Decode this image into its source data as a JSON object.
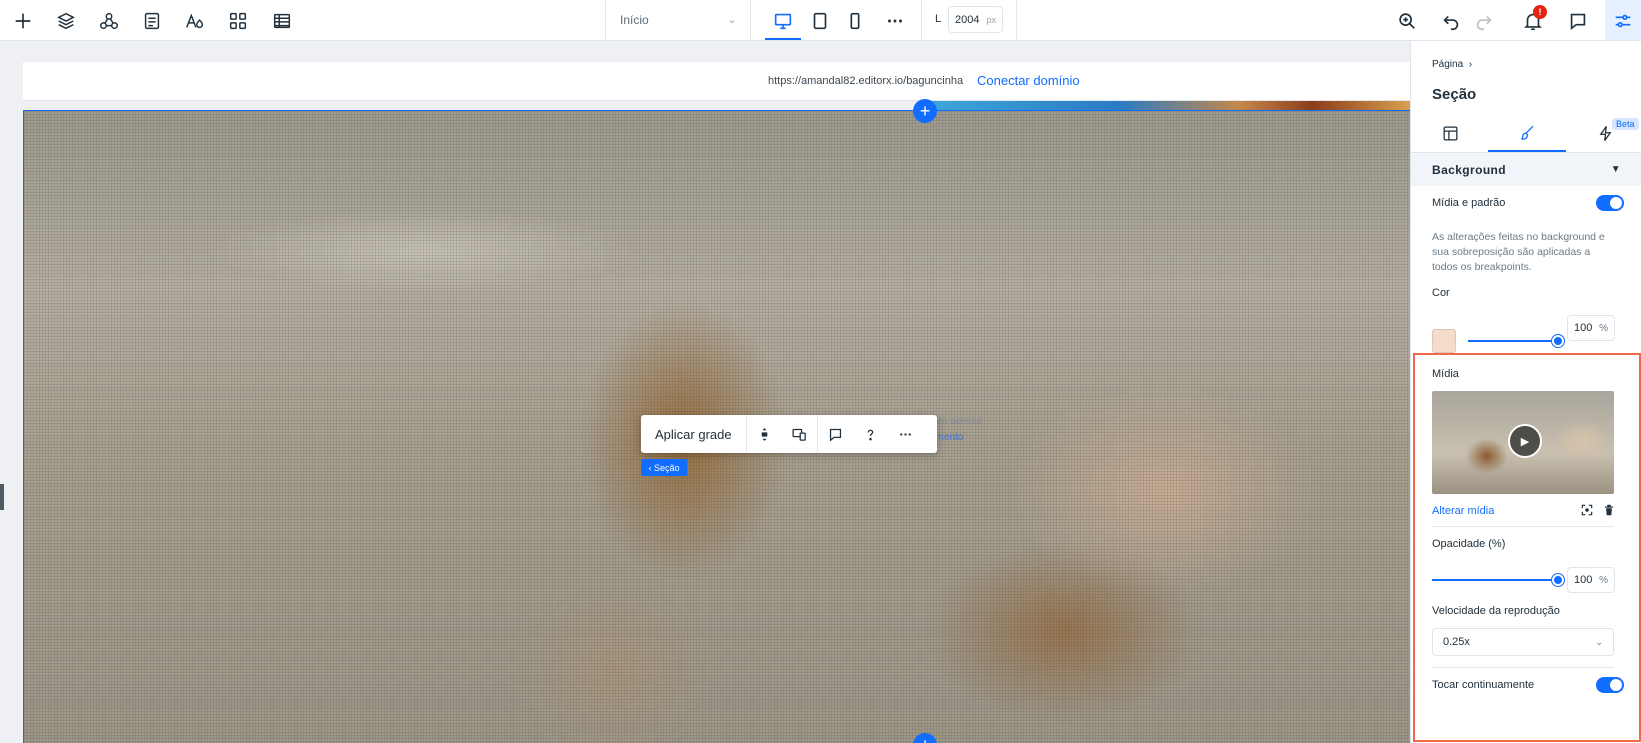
{
  "topbar": {
    "page_select": "Início",
    "width_label": "L",
    "width_value": "2004",
    "width_unit": "px",
    "notifications_count": "!"
  },
  "canvas": {
    "url": "https://amandal82.editorx.io/baguncinha",
    "connect_domain": "Conectar domínio",
    "section_tag": "‹ Seção",
    "ghost_text": "ram acesso",
    "ghost_link": "amento"
  },
  "float_toolbar": {
    "apply_grid": "Aplicar grade"
  },
  "panel": {
    "breadcrumb": "Página",
    "title": "Seção",
    "beta": "Beta",
    "background_header": "Background",
    "media_pattern_label": "Mídia e padrão",
    "media_pattern_on": true,
    "note": "As alterações feitas no background e sua sobreposição são aplicadas a todos os breakpoints.",
    "color_label": "Cor",
    "color_swatch": "#f5dcca",
    "color_opacity": "100",
    "color_opacity_fraction": 1.0,
    "percent": "%",
    "media_label": "Mídia",
    "change_media": "Alterar mídia",
    "opacity_label": "Opacidade (%)",
    "opacity_value": "100",
    "opacity_fraction": 1.0,
    "speed_label": "Velocidade da reprodução",
    "speed_value": "0.25x",
    "loop_label": "Tocar continuamente",
    "loop_on": true
  },
  "colors": {
    "accent": "#116dff",
    "highlight": "#f2684a"
  }
}
